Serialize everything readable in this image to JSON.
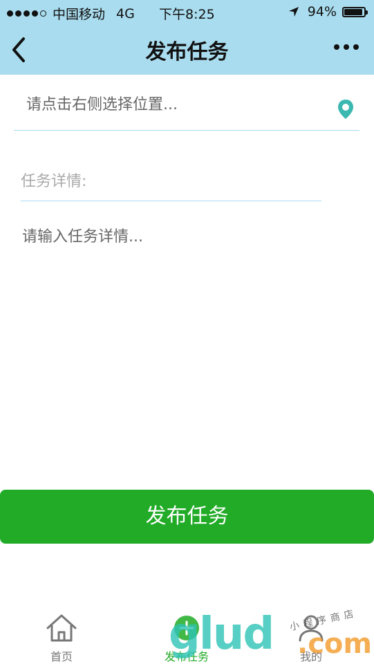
{
  "status_bar": {
    "carrier": "中国移动",
    "network": "4G",
    "time": "下午8:25",
    "battery": "94%",
    "battery_level": 0.94,
    "signal_bars": 4,
    "signal_total": 5
  },
  "nav": {
    "title": "发布任务",
    "back_icon": "chevron-left-icon",
    "more_icon": "more-dots-icon"
  },
  "form": {
    "location_placeholder": "请点击右侧选择位置...",
    "location_value": "",
    "detail_label": "任务详情:",
    "detail_placeholder": "请输入任务详情...",
    "detail_value": ""
  },
  "submit_label": "发布任务",
  "tabs": [
    {
      "label": "首页",
      "icon": "home-icon",
      "active": false
    },
    {
      "label": "发布任务",
      "icon": "publish-icon",
      "active": true
    },
    {
      "label": "我的",
      "icon": "user-icon",
      "active": false
    }
  ],
  "watermark": {
    "main": "glud",
    "suffix": ".com",
    "sub": "小程序商店"
  },
  "colors": {
    "header_bg": "#a9dcee",
    "accent_green": "#21ab27",
    "pin_teal": "#3bb8b0",
    "divider": "#a9dcee"
  }
}
